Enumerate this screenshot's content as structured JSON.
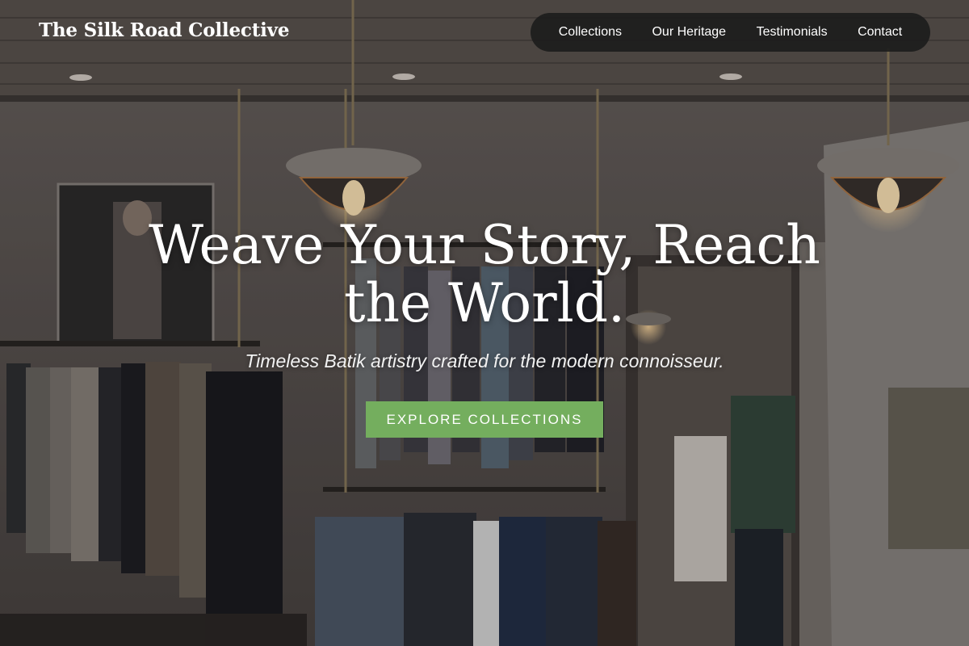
{
  "brand": {
    "name": "The Silk Road Collective"
  },
  "nav": {
    "items": [
      {
        "label": "Collections"
      },
      {
        "label": "Our Heritage"
      },
      {
        "label": "Testimonials"
      },
      {
        "label": "Contact"
      }
    ]
  },
  "hero": {
    "title": "Weave Your Story, Reach the World.",
    "subtitle": "Timeless Batik artistry crafted for the modern connoisseur.",
    "cta_label": "EXPLORE COLLECTIONS",
    "background": "photo of a clothing boutique interior with hanging pendant lamps and garment racks"
  },
  "colors": {
    "cta": "#74ae5e",
    "nav_bg": "#1c1c1c",
    "text": "#ffffff"
  }
}
